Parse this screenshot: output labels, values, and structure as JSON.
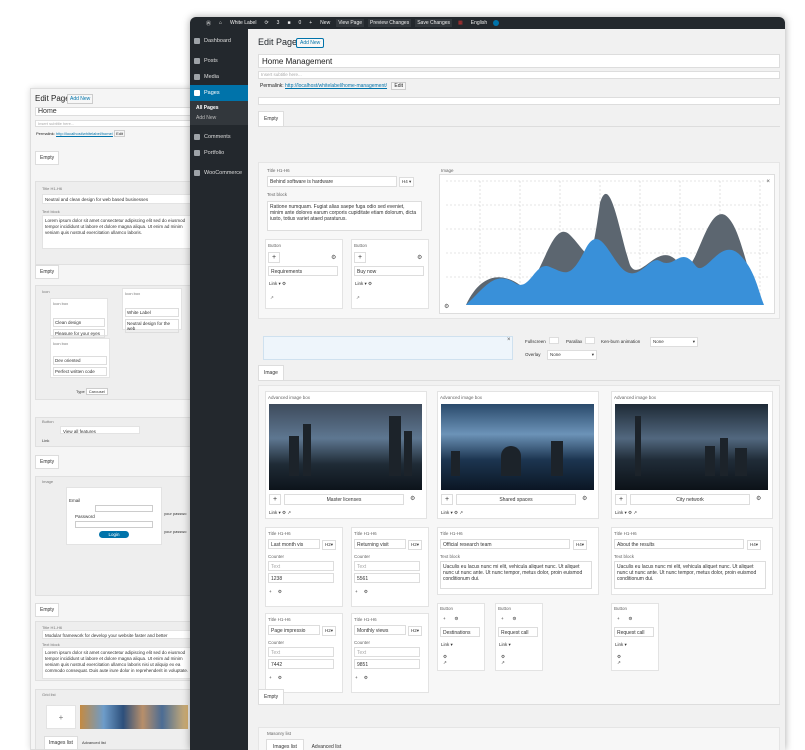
{
  "back": {
    "title": "Edit Page",
    "add_new": "Add New",
    "page_title": "Home",
    "subtitle_placeholder": "Insert subtitle here...",
    "permalink_label": "Permalink:",
    "permalink_url": "http://localhost/whitelabel/home/",
    "edit": "Edit",
    "tab_empty": "Empty",
    "title_label": "Title H1-H6",
    "title_value": "Neutral and clean design for web based businesses",
    "text_block_label": "Text block",
    "text_block": "Lorem ipsum dolor sit amet consectetur adipiscing elit sed do eiusmod tempor incididunt ut labore et dolore magna aliqua. Ut enim ad minim veniam quis nostrud exercitation ullamco laboris.",
    "tab_empty2": "Empty",
    "icons_label": "Icon",
    "icon_box_label": "Icon box",
    "icon_items": [
      "Clean design",
      "Pleasure for your eyes",
      "White Label",
      "Neutral design for the web",
      "Dev oriented",
      "Perfect written code"
    ],
    "type_label": "Type",
    "type_value": "Carousel",
    "button_label": "Button",
    "view_all": "View all features",
    "link_label": "Link",
    "tab_empty3": "Empty",
    "image_label": "Image",
    "email_label": "Email",
    "password_label": "Password",
    "login": "Login",
    "your_pass1": "your passwo",
    "your_pass2": "your passwo",
    "tab_empty4": "Empty",
    "title2": "Modular framework for develop your website faster and better",
    "text_block2": "Lorem ipsum dolor sit amet consectetur adipiscing elit sed do eiusmod tempor incididunt ut labore et dolore magna aliqua. Ut enim ad minim veniam quis nostrud exercitation ullamco laboris nisi ut aliquip ex ea commodo consequat. Duis aute irure dolor in reprehenderit in voluptate.",
    "grid_list": "Grid list",
    "tab_images": "Images list",
    "tab_advanced": "Advanced list"
  },
  "adminbar": {
    "site": "White Label",
    "updates": "3",
    "comments": "0",
    "new": "New",
    "view_page": "View Page",
    "preview": "Preview Changes",
    "save": "Save Changes",
    "language": "English"
  },
  "sidebar": {
    "items": [
      "Dashboard",
      "Posts",
      "Media",
      "Pages",
      "Comments",
      "Portfolio",
      "WooCommerce"
    ],
    "sub": [
      "All Pages",
      "Add New"
    ]
  },
  "main": {
    "title": "Edit Page",
    "add_new": "Add New",
    "page_title": "Home Management",
    "subtitle_placeholder": "Insert subtitle here...",
    "permalink_label": "Permalink:",
    "permalink_url": "http://localhost/whitelabel/home-management/",
    "edit": "Edit",
    "tab_empty": "Empty",
    "hero": {
      "title_label": "Title H1-H6",
      "title_value": "Behind software is hardware",
      "heading": "H4",
      "text_label": "Text block",
      "text_value": "Ratione numquam. Fugiat alias saepe fuga odio sed eveniet, minim ante dolores earum corporis cupiditate etiam dolorum, dicta iusto, totius variet ataed paraturus.",
      "buttons": [
        {
          "label": "Button",
          "text": "Requirements",
          "link": "Link"
        },
        {
          "label": "Button",
          "text": "Buy now",
          "link": "Link"
        }
      ],
      "image_label": "Image"
    },
    "settings": {
      "fullscreen": "Fullscreen",
      "parallax": "Parallax",
      "kenburn": "Ken-burn animation",
      "kenburn_value": "None",
      "overlay": "Overlay",
      "overlay_value": "None"
    },
    "tab_image": "Image",
    "advanced": [
      {
        "label": "Advanced image box",
        "caption": "Master licenses",
        "link": "Link"
      },
      {
        "label": "Advanced image box",
        "caption": "Shared spaces",
        "link": "Link"
      },
      {
        "label": "Advanced image box",
        "caption": "City network",
        "link": "Link"
      }
    ],
    "counters": [
      {
        "title_label": "Title H1-H6",
        "title": "Last month vis",
        "h": "H2",
        "counter_label": "Counter",
        "text_ph": "Text",
        "value": "1238"
      },
      {
        "title_label": "Title H1-H6",
        "title": "Returning visit",
        "h": "H2",
        "counter_label": "Counter",
        "text_ph": "Text",
        "value": "5561"
      },
      {
        "title_label": "Title H1-H6",
        "title": "Page impressio",
        "h": "H2",
        "counter_label": "Counter",
        "text_ph": "Text",
        "value": "7442"
      },
      {
        "title_label": "Title H1-H6",
        "title": "Monthly views",
        "h": "H2",
        "counter_label": "Counter",
        "text_ph": "Text",
        "value": "9851"
      }
    ],
    "research": {
      "title_label": "Title H1-H6",
      "title": "Official research team",
      "h": "H4",
      "text_label": "Text block",
      "text": "Uaculis eu lacus nunc mi elit, vehicula aliquet nunc. Ut aliquet nunc ut nunc ante. Ut nunc tempor, metus dolor, proin euismod conditionum dui."
    },
    "results": {
      "title_label": "Title H1-H6",
      "title": "About the results",
      "h": "H4",
      "text_label": "Text block",
      "text": "Uaculis eu lacus nunc mi elit, vehicula aliquet nunc. Ut aliquet nunc ut nunc ante. Ut nunc tempor, metus dolor, proin euismod conditionum dui."
    },
    "small_buttons": [
      {
        "label": "Button",
        "text": "Destinations",
        "link": "Link"
      },
      {
        "label": "Button",
        "text": "Request call",
        "link": "Link"
      },
      {
        "label": "Button",
        "text": "Request call",
        "link": "Link"
      }
    ],
    "tab_empty2": "Empty",
    "masonry_label": "Masonry list",
    "tab_images": "Images list",
    "tab_advanced": "Advanced list"
  }
}
